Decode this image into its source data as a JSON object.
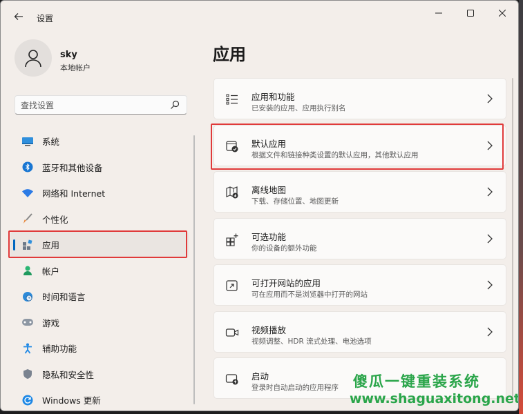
{
  "window": {
    "title": "设置"
  },
  "user": {
    "name": "sky",
    "account_type": "本地帐户"
  },
  "search": {
    "placeholder": "查找设置"
  },
  "nav": {
    "items": [
      {
        "label": "系统",
        "icon": "monitor-icon"
      },
      {
        "label": "蓝牙和其他设备",
        "icon": "bluetooth-icon"
      },
      {
        "label": "网络和 Internet",
        "icon": "wifi-icon"
      },
      {
        "label": "个性化",
        "icon": "brush-icon"
      },
      {
        "label": "应用",
        "icon": "apps-icon",
        "active": true
      },
      {
        "label": "帐户",
        "icon": "person-icon"
      },
      {
        "label": "时间和语言",
        "icon": "globe-clock-icon"
      },
      {
        "label": "游戏",
        "icon": "gamepad-icon"
      },
      {
        "label": "辅助功能",
        "icon": "accessibility-icon"
      },
      {
        "label": "隐私和安全性",
        "icon": "shield-icon"
      },
      {
        "label": "Windows 更新",
        "icon": "update-icon"
      }
    ]
  },
  "main": {
    "title": "应用",
    "cards": [
      {
        "title": "应用和功能",
        "subtitle": "已安装的应用、应用执行别名",
        "icon": "list-icon"
      },
      {
        "title": "默认应用",
        "subtitle": "根据文件和链接种类设置的默认应用，其他默认应用",
        "icon": "default-apps-icon"
      },
      {
        "title": "离线地图",
        "subtitle": "下载、存储位置、地图更新",
        "icon": "map-icon"
      },
      {
        "title": "可选功能",
        "subtitle": "你的设备的额外功能",
        "icon": "add-feature-icon"
      },
      {
        "title": "可打开网站的应用",
        "subtitle": "可在应用而不是浏览器中打开的网站",
        "icon": "open-external-icon"
      },
      {
        "title": "视频播放",
        "subtitle": "视频调整、HDR 流式处理、电池选项",
        "icon": "video-icon"
      },
      {
        "title": "启动",
        "subtitle": "登录时自动启动的应用程序",
        "icon": "startup-icon"
      }
    ]
  },
  "watermark": {
    "line1": "傻瓜一键重装系统",
    "line2": "www.shaguaxitong.net"
  },
  "colors": {
    "accent": "#0067c0",
    "highlight": "#e03a3a",
    "watermark": "#2aa54a"
  }
}
